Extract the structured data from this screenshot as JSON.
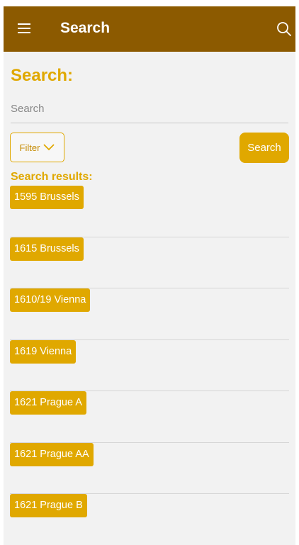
{
  "appbar": {
    "title": "Search",
    "menu_icon": "hamburger-menu-icon",
    "search_icon": "search-icon"
  },
  "colors": {
    "appbar_bg": "#8c5a00",
    "accent": "#e0a800",
    "background": "#f2f2f2"
  },
  "main": {
    "heading": "Search:",
    "search_placeholder": "Search",
    "search_value": "",
    "filter_label": "Filter",
    "filter_icon": "chevron-down-icon",
    "search_button_label": "Search",
    "results_heading": "Search results:"
  },
  "results": [
    {
      "label": "1595 Brussels"
    },
    {
      "label": "1615 Brussels"
    },
    {
      "label": "1610/19 Vienna"
    },
    {
      "label": "1619 Vienna"
    },
    {
      "label": "1621 Prague A"
    },
    {
      "label": "1621 Prague AA"
    },
    {
      "label": "1621 Prague B"
    }
  ]
}
